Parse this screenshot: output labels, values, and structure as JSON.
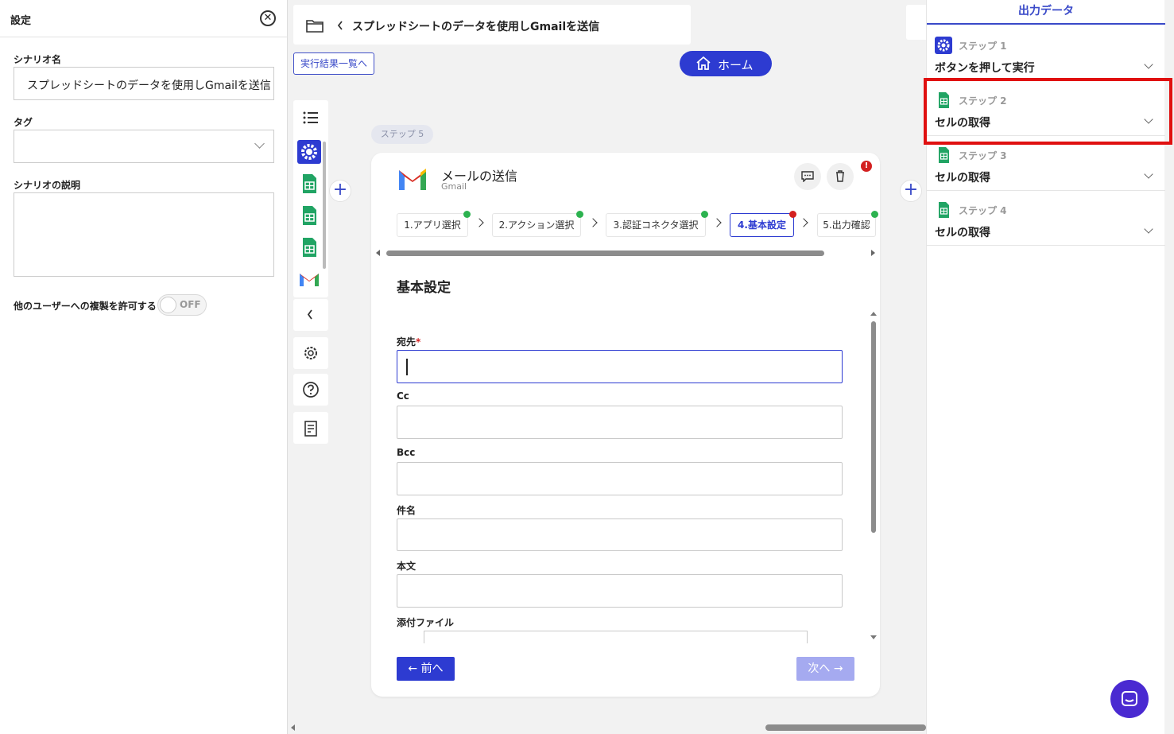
{
  "left_panel": {
    "title": "設定",
    "scenario_name_label": "シナリオ名",
    "scenario_name_value": "スプレッドシートのデータを使用しGmailを送信",
    "tag_label": "タグ",
    "description_label": "シナリオの説明",
    "duplicate_label": "他のユーザーへの複製を許可する",
    "duplicate_toggle": "OFF"
  },
  "header": {
    "breadcrumb_title": "スプレッドシートのデータを使用しGmailを送信",
    "results_link": "実行結果一覧へ",
    "home_button": "ホーム"
  },
  "step_card": {
    "step_pill": "ステップ 5",
    "app_title": "メールの送信",
    "app_sub": "Gmail",
    "tabs": [
      {
        "label": "1.アプリ選択",
        "status": "ok"
      },
      {
        "label": "2.アクション選択",
        "status": "ok"
      },
      {
        "label": "3.認証コネクタ選択",
        "status": "ok"
      },
      {
        "label": "4.基本設定",
        "status": "error"
      },
      {
        "label": "5.出力確認",
        "status": "ok"
      }
    ],
    "section_title": "基本設定",
    "fields": {
      "to_label": "宛先",
      "required_mark": "*",
      "cc_label": "Cc",
      "bcc_label": "Bcc",
      "subject_label": "件名",
      "body_label": "本文",
      "attachment_label": "添付ファイル"
    },
    "prev_button": "← 前へ",
    "next_button": "次へ →"
  },
  "right_panel": {
    "title": "出力データ",
    "steps": [
      {
        "label": "ステップ 1",
        "name": "ボタンを押して実行",
        "icon": "gear-icon"
      },
      {
        "label": "ステップ 2",
        "name": "セルの取得",
        "icon": "sheets-icon"
      },
      {
        "label": "ステップ 3",
        "name": "セルの取得",
        "icon": "sheets-icon"
      },
      {
        "label": "ステップ 4",
        "name": "セルの取得",
        "icon": "sheets-icon"
      }
    ]
  },
  "colors": {
    "accent": "#2d3bd1",
    "highlight": "#e01010",
    "sheets_green": "#21a464",
    "ok": "#2cb24f",
    "error": "#d32020"
  }
}
